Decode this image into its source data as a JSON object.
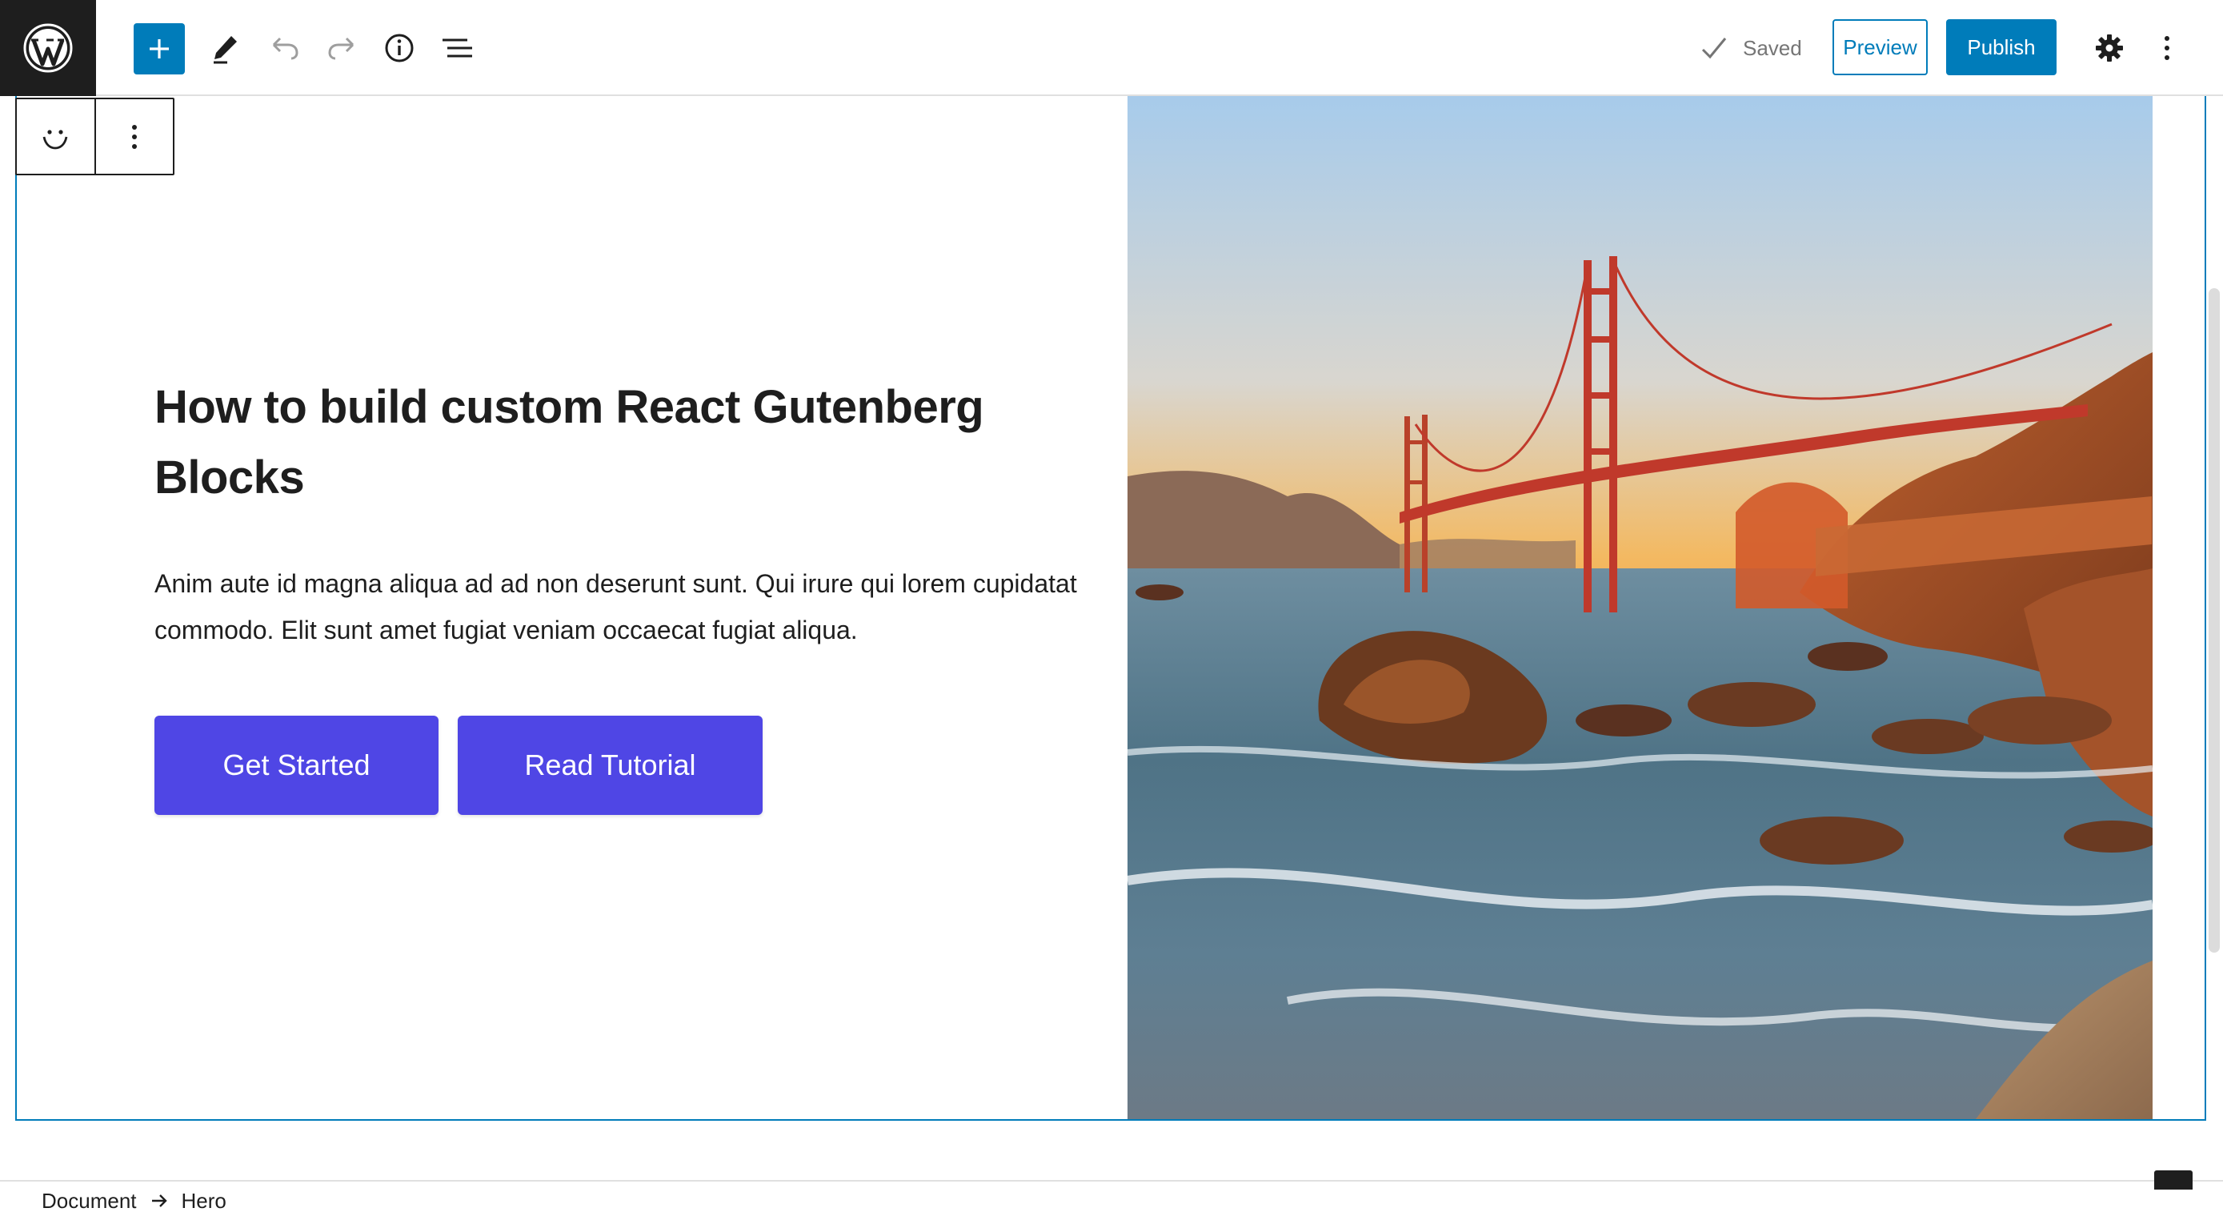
{
  "topbar": {
    "icons": {
      "logo": "wordpress-logo",
      "add": "plus-icon",
      "edit": "pencil-icon",
      "undo": "undo-icon",
      "redo": "redo-icon",
      "info": "info-icon",
      "list": "list-view-icon",
      "settings": "gear-icon",
      "more": "kebab-menu-icon"
    },
    "saved_label": "Saved",
    "preview_label": "Preview",
    "publish_label": "Publish"
  },
  "block_toolbar": {
    "icons": [
      "smiley-block-icon",
      "kebab-menu-icon"
    ]
  },
  "hero": {
    "title": "How to build custom React Gutenberg Blocks",
    "text": "Anim aute id magna aliqua ad ad non deserunt sunt. Qui irure qui lorem cupidatat commodo. Elit sunt amet fugiat veniam occaecat fugiat aliqua.",
    "buttons": [
      {
        "label": "Get Started"
      },
      {
        "label": "Read Tutorial"
      }
    ],
    "image_alt": "Golden Gate Bridge at sunset over a rocky beach"
  },
  "breadcrumb": {
    "items": [
      "Document",
      "Hero"
    ]
  },
  "colors": {
    "accent": "#007cba",
    "cta": "#4f46e5",
    "toolbar_dark": "#1e1e1e",
    "muted": "#757575"
  }
}
